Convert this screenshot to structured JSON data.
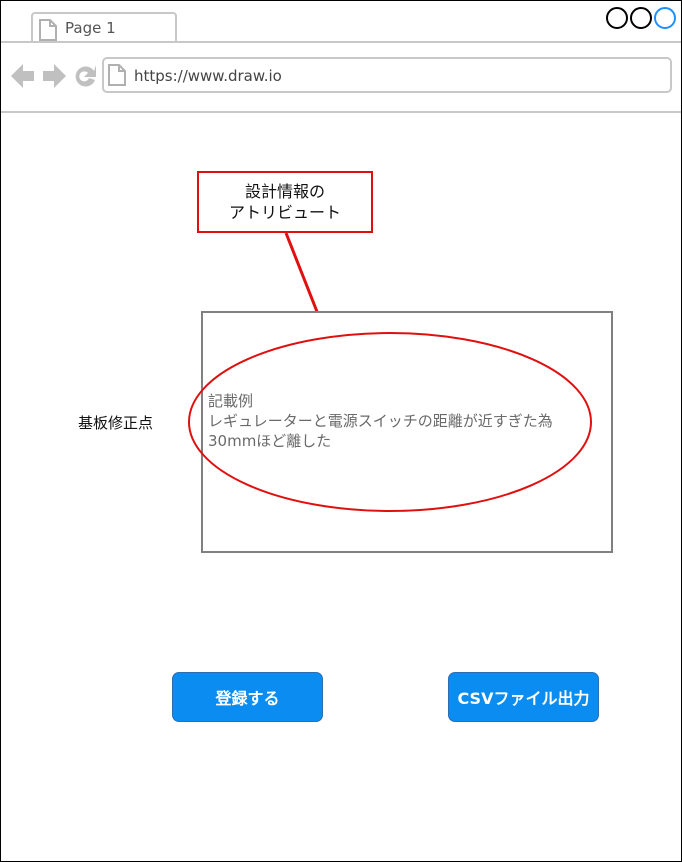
{
  "browser": {
    "tab": {
      "label": "Page 1",
      "icon": "document-icon"
    },
    "url": "https://www.draw.io",
    "nav_icons": [
      "back-arrow-icon",
      "forward-arrow-icon",
      "refresh-icon"
    ],
    "window_controls": [
      "circle-icon",
      "circle-icon",
      "circle-icon"
    ],
    "window_control_colors": [
      "#000000",
      "#000000",
      "#1e90ff"
    ]
  },
  "callout": {
    "line1": "設計情報の",
    "line2": "アトリビュート",
    "color": "#e01010"
  },
  "form": {
    "field_label": "基板修正点",
    "example_lines": [
      "記載例",
      "レギュレーターと電源スイッチの距離が近すぎた為",
      "30mmほど離した"
    ]
  },
  "buttons": {
    "register": "登録する",
    "csv_export": "CSVファイル出力",
    "color": "#0a8cf0"
  }
}
